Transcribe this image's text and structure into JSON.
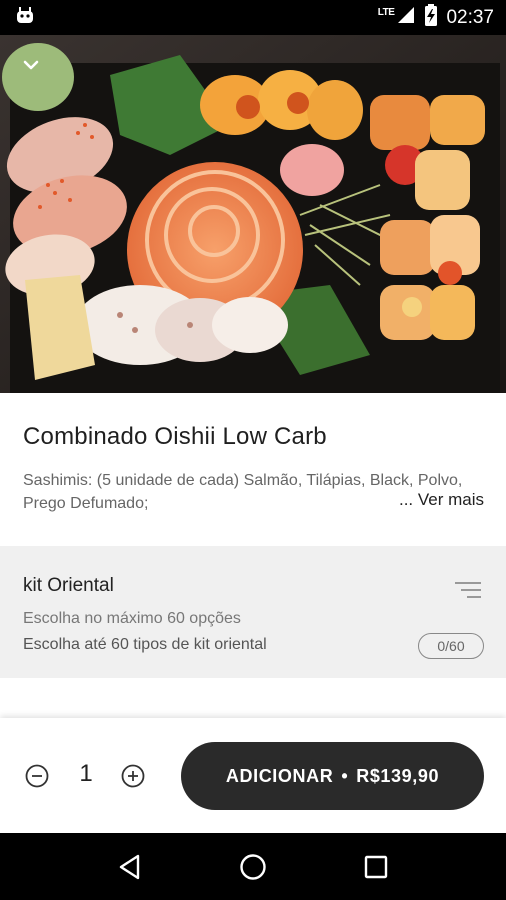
{
  "status_bar": {
    "network": "LTE",
    "time": "02:37",
    "icons": [
      "android-icon",
      "signal-icon",
      "battery-charging-icon"
    ]
  },
  "hero": {
    "image_alt": "Combinado Oishii Low Carb sushi platter",
    "collapse_icon": "chevron-down-icon"
  },
  "product": {
    "title": "Combinado Oishii Low Carb",
    "description": "Sashimis: (5 unidade de cada) Salmão, Tilápias, Black, Polvo, Prego Defumado;",
    "see_more": "... Ver mais"
  },
  "option_group": {
    "title": "kit Oriental",
    "max_label": "Escolha no máximo 60 opções",
    "subtitle": "Escolha até 60 tipos de kit oriental",
    "counter": "0/60",
    "icon": "filter-icon"
  },
  "next_item": {
    "label": "",
    "price": ""
  },
  "footer": {
    "quantity": "1",
    "add_label": "ADICIONAR",
    "separator": "•",
    "price": "R$139,90"
  },
  "nav": {
    "back_icon": "back-icon",
    "home_icon": "home-icon",
    "recents_icon": "recents-icon"
  },
  "colors": {
    "button_bg": "#2a2a2a",
    "section_bg": "#f0f0f0"
  }
}
